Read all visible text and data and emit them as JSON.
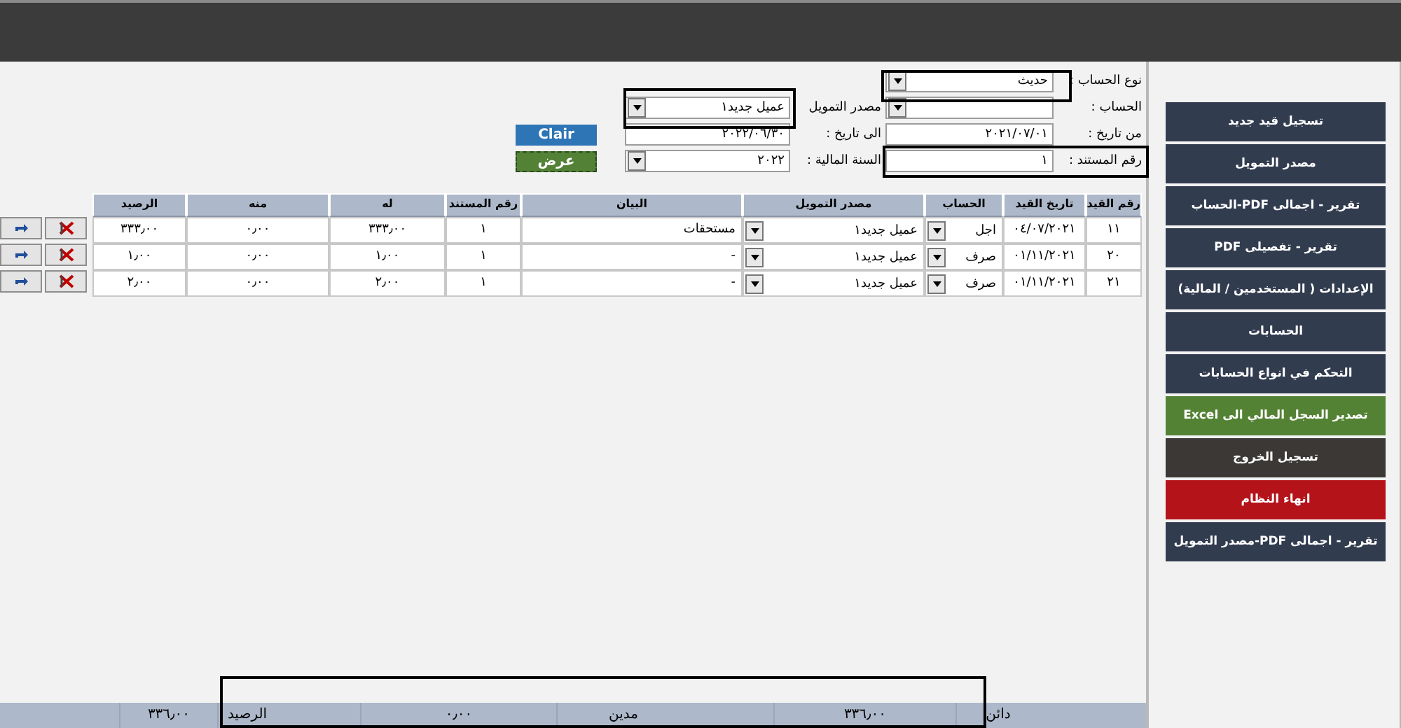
{
  "filter_rows": [
    {
      "fields": [
        {
          "label": "نوع الحساب :",
          "value": "حديث",
          "kind": "select"
        }
      ]
    },
    {
      "fields": [
        {
          "label": "الحساب :",
          "kind": "select"
        },
        {
          "label": "مصدر التمويل",
          "value": "عميل جديد١",
          "kind": "select"
        }
      ]
    },
    {
      "fields": [
        {
          "label": "من تاريخ :",
          "value": "٢٠٢١/٠٧/٠١",
          "kind": "text"
        },
        {
          "label": "الى  تاريخ :",
          "value": "٢٠٢٢/٠٦/٣٠",
          "kind": "text"
        }
      ],
      "button": {
        "label": "Clair",
        "kind": "clear"
      }
    },
    {
      "fields": [
        {
          "label": "رقم المستند :",
          "value": "١",
          "kind": "text"
        },
        {
          "label": "السنة المالية :",
          "value": "٢٠٢٢",
          "kind": "select"
        }
      ],
      "button": {
        "label": "عرض",
        "kind": "show"
      }
    }
  ],
  "table": {
    "columns": [
      "رقم القيد",
      "تاريخ القيد",
      "الحساب",
      "مصدر التمويل",
      "البيان",
      "رقم المستند",
      "له",
      "منه",
      "الرصيد"
    ],
    "rows": [
      {
        "entry_no": "١١",
        "date": "٠٤/٠٧/٢٠٢١",
        "account": "اجل",
        "funding": "عميل جديد١",
        "statement": "مستحقات",
        "doc_no": "١",
        "credit": "٣٣٣٫٠٠",
        "debit": "٠٫٠٠",
        "balance": "٣٣٣٫٠٠"
      },
      {
        "entry_no": "٢٠",
        "date": "٠١/١١/٢٠٢١",
        "account": "صرف",
        "funding": "عميل جديد١",
        "statement": "-",
        "doc_no": "١",
        "credit": "١٫٠٠",
        "debit": "٠٫٠٠",
        "balance": "١٫٠٠"
      },
      {
        "entry_no": "٢١",
        "date": "٠١/١١/٢٠٢١",
        "account": "صرف",
        "funding": "عميل جديد١",
        "statement": "-",
        "doc_no": "١",
        "credit": "٢٫٠٠",
        "debit": "٠٫٠٠",
        "balance": "٢٫٠٠"
      }
    ]
  },
  "sidebar": {
    "buttons": [
      {
        "label": "تسجيل قيد جديد",
        "kind": "nav"
      },
      {
        "label": "مصدر التمويل",
        "kind": "nav"
      },
      {
        "label": "تقرير - اجمالى PDF-الحساب",
        "kind": "nav"
      },
      {
        "label": "تقرير - تفصيلى PDF",
        "kind": "nav"
      },
      {
        "label": "الإعدادات ( المستخدمين / المالية)",
        "kind": "nav"
      },
      {
        "label": "الحسابات",
        "kind": "nav"
      },
      {
        "label": "التحكم في انواع الحسابات",
        "kind": "nav"
      },
      {
        "label": "تصدير السجل المالي الى Excel",
        "kind": "export"
      },
      {
        "label": "تسجيل الخروج",
        "kind": "logout"
      },
      {
        "label": "انهاء النظام",
        "kind": "exit"
      },
      {
        "label": "تقرير - اجمالى PDF-مصدر التمويل",
        "kind": "nav"
      }
    ]
  },
  "totals": [
    {
      "label": "دائن",
      "value": "٣٣٦٫٠٠"
    },
    {
      "label": "مدين",
      "value": "٠٫٠٠"
    },
    {
      "label": "الرصيد",
      "value": "٣٣٦٫٠٠"
    }
  ]
}
